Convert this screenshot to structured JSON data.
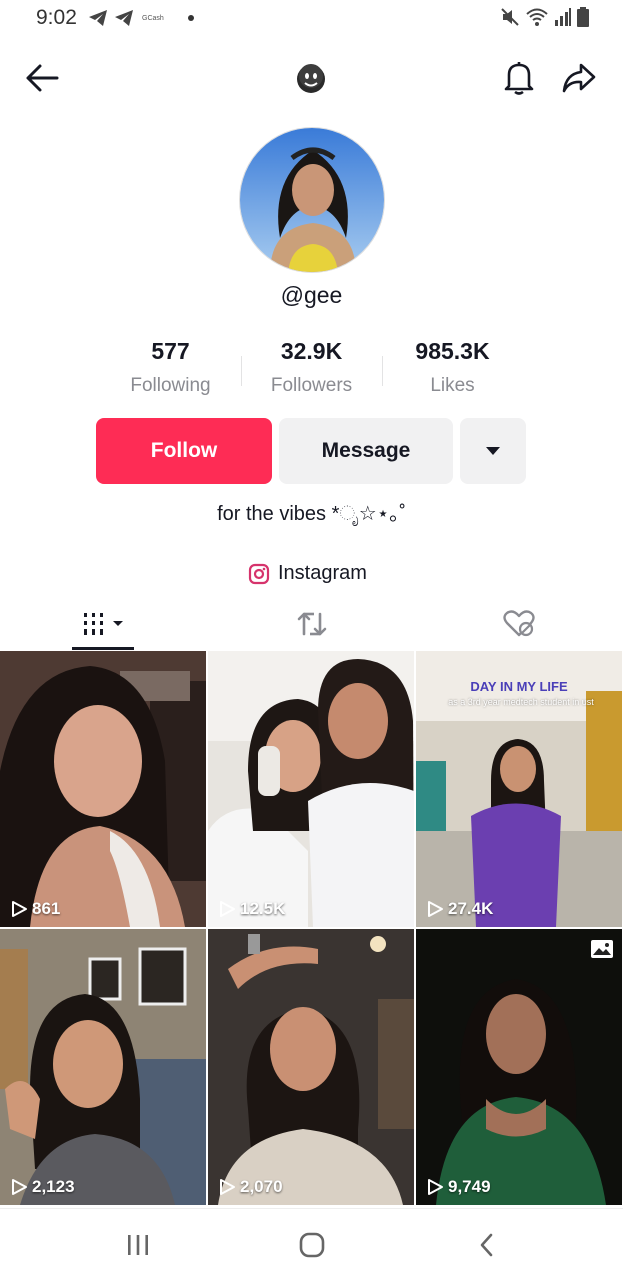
{
  "status_bar": {
    "time": "9:02",
    "gcash_label": "GCash"
  },
  "profile": {
    "username": "@gee",
    "bio": "for the vibes *ೃ☆⋆｡˚",
    "instagram_label": "Instagram"
  },
  "stats": [
    {
      "value": "577",
      "label": "Following"
    },
    {
      "value": "32.9K",
      "label": "Followers"
    },
    {
      "value": "985.3K",
      "label": "Likes"
    }
  ],
  "buttons": {
    "follow": "Follow",
    "message": "Message"
  },
  "videos": [
    {
      "views": "861"
    },
    {
      "views": "12.5K"
    },
    {
      "views": "27.4K",
      "overlay_title": "DAY IN MY LIFE",
      "overlay_sub": "as a 3rd year medtech student in ust"
    },
    {
      "views": "2,123"
    },
    {
      "views": "2,070"
    },
    {
      "views": "9,749"
    }
  ],
  "colors": {
    "follow": "#fe2c55",
    "secondary_button": "#f1f1f2",
    "muted_text": "#8a8b91"
  }
}
